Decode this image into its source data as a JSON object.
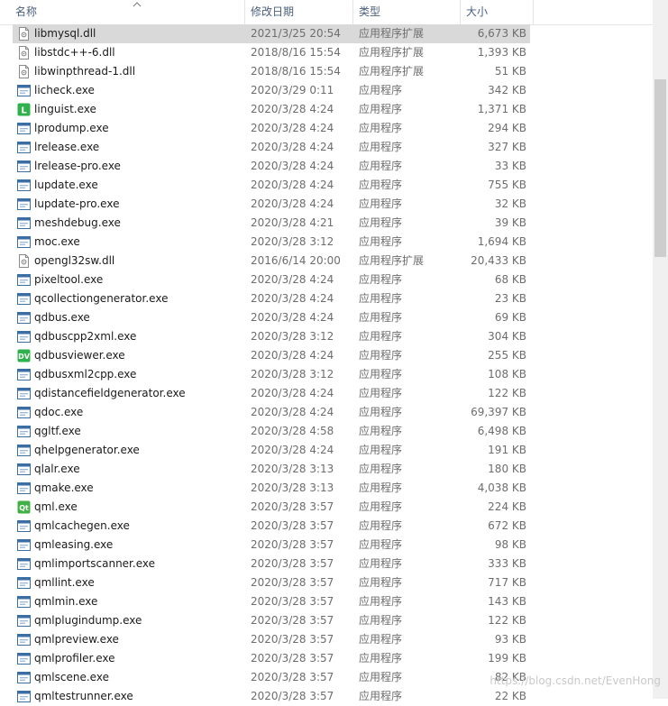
{
  "columns": {
    "name": "名称",
    "date": "修改日期",
    "type": "类型",
    "size": "大小"
  },
  "colors": {
    "selected_row": "#d9d9d9",
    "header_text": "#4c607a",
    "secondary_text": "#6d6d6d",
    "scroll_thumb": "#cdcdcd"
  },
  "files": [
    {
      "name": "libmysql.dll",
      "date": "2021/3/25 20:54",
      "type": "应用程序扩展",
      "size": "6,673 KB",
      "icon": "dll-icon",
      "selected": true
    },
    {
      "name": "libstdc++-6.dll",
      "date": "2018/8/16 15:54",
      "type": "应用程序扩展",
      "size": "1,393 KB",
      "icon": "dll-icon"
    },
    {
      "name": "libwinpthread-1.dll",
      "date": "2018/8/16 15:54",
      "type": "应用程序扩展",
      "size": "51 KB",
      "icon": "dll-icon"
    },
    {
      "name": "licheck.exe",
      "date": "2020/3/29 0:11",
      "type": "应用程序",
      "size": "342 KB",
      "icon": "exe-icon"
    },
    {
      "name": "linguist.exe",
      "date": "2020/3/28 4:24",
      "type": "应用程序",
      "size": "1,371 KB",
      "icon": "linguist-icon"
    },
    {
      "name": "lprodump.exe",
      "date": "2020/3/28 4:24",
      "type": "应用程序",
      "size": "294 KB",
      "icon": "exe-icon"
    },
    {
      "name": "lrelease.exe",
      "date": "2020/3/28 4:24",
      "type": "应用程序",
      "size": "327 KB",
      "icon": "exe-icon"
    },
    {
      "name": "lrelease-pro.exe",
      "date": "2020/3/28 4:24",
      "type": "应用程序",
      "size": "33 KB",
      "icon": "exe-icon"
    },
    {
      "name": "lupdate.exe",
      "date": "2020/3/28 4:24",
      "type": "应用程序",
      "size": "755 KB",
      "icon": "exe-icon"
    },
    {
      "name": "lupdate-pro.exe",
      "date": "2020/3/28 4:24",
      "type": "应用程序",
      "size": "32 KB",
      "icon": "exe-icon"
    },
    {
      "name": "meshdebug.exe",
      "date": "2020/3/28 4:21",
      "type": "应用程序",
      "size": "39 KB",
      "icon": "exe-icon"
    },
    {
      "name": "moc.exe",
      "date": "2020/3/28 3:12",
      "type": "应用程序",
      "size": "1,694 KB",
      "icon": "exe-icon"
    },
    {
      "name": "opengl32sw.dll",
      "date": "2016/6/14 20:00",
      "type": "应用程序扩展",
      "size": "20,433 KB",
      "icon": "dll-icon"
    },
    {
      "name": "pixeltool.exe",
      "date": "2020/3/28 4:24",
      "type": "应用程序",
      "size": "68 KB",
      "icon": "exe-icon"
    },
    {
      "name": "qcollectiongenerator.exe",
      "date": "2020/3/28 4:24",
      "type": "应用程序",
      "size": "23 KB",
      "icon": "exe-icon"
    },
    {
      "name": "qdbus.exe",
      "date": "2020/3/28 4:24",
      "type": "应用程序",
      "size": "69 KB",
      "icon": "exe-icon"
    },
    {
      "name": "qdbuscpp2xml.exe",
      "date": "2020/3/28 3:12",
      "type": "应用程序",
      "size": "304 KB",
      "icon": "exe-icon"
    },
    {
      "name": "qdbusviewer.exe",
      "date": "2020/3/28 4:24",
      "type": "应用程序",
      "size": "255 KB",
      "icon": "dbusviewer-icon"
    },
    {
      "name": "qdbusxml2cpp.exe",
      "date": "2020/3/28 3:12",
      "type": "应用程序",
      "size": "108 KB",
      "icon": "exe-icon"
    },
    {
      "name": "qdistancefieldgenerator.exe",
      "date": "2020/3/28 4:24",
      "type": "应用程序",
      "size": "122 KB",
      "icon": "exe-icon"
    },
    {
      "name": "qdoc.exe",
      "date": "2020/3/28 4:24",
      "type": "应用程序",
      "size": "69,397 KB",
      "icon": "exe-icon"
    },
    {
      "name": "qgltf.exe",
      "date": "2020/3/28 4:58",
      "type": "应用程序",
      "size": "6,498 KB",
      "icon": "exe-icon"
    },
    {
      "name": "qhelpgenerator.exe",
      "date": "2020/3/28 4:24",
      "type": "应用程序",
      "size": "191 KB",
      "icon": "exe-icon"
    },
    {
      "name": "qlalr.exe",
      "date": "2020/3/28 3:13",
      "type": "应用程序",
      "size": "180 KB",
      "icon": "exe-icon"
    },
    {
      "name": "qmake.exe",
      "date": "2020/3/28 3:13",
      "type": "应用程序",
      "size": "4,038 KB",
      "icon": "exe-icon"
    },
    {
      "name": "qml.exe",
      "date": "2020/3/28 3:57",
      "type": "应用程序",
      "size": "224 KB",
      "icon": "qt-icon"
    },
    {
      "name": "qmlcachegen.exe",
      "date": "2020/3/28 3:57",
      "type": "应用程序",
      "size": "672 KB",
      "icon": "exe-icon"
    },
    {
      "name": "qmleasing.exe",
      "date": "2020/3/28 3:57",
      "type": "应用程序",
      "size": "98 KB",
      "icon": "exe-icon"
    },
    {
      "name": "qmlimportscanner.exe",
      "date": "2020/3/28 3:57",
      "type": "应用程序",
      "size": "333 KB",
      "icon": "exe-icon"
    },
    {
      "name": "qmllint.exe",
      "date": "2020/3/28 3:57",
      "type": "应用程序",
      "size": "717 KB",
      "icon": "exe-icon"
    },
    {
      "name": "qmlmin.exe",
      "date": "2020/3/28 3:57",
      "type": "应用程序",
      "size": "143 KB",
      "icon": "exe-icon"
    },
    {
      "name": "qmlplugindump.exe",
      "date": "2020/3/28 3:57",
      "type": "应用程序",
      "size": "122 KB",
      "icon": "exe-icon"
    },
    {
      "name": "qmlpreview.exe",
      "date": "2020/3/28 3:57",
      "type": "应用程序",
      "size": "93 KB",
      "icon": "exe-icon"
    },
    {
      "name": "qmlprofiler.exe",
      "date": "2020/3/28 3:57",
      "type": "应用程序",
      "size": "199 KB",
      "icon": "exe-icon"
    },
    {
      "name": "qmlscene.exe",
      "date": "2020/3/28 3:57",
      "type": "应用程序",
      "size": "82 KB",
      "icon": "exe-icon"
    },
    {
      "name": "qmltestrunner.exe",
      "date": "2020/3/28 3:57",
      "type": "应用程序",
      "size": "22 KB",
      "icon": "exe-icon"
    }
  ],
  "watermark": "https://blog.csdn.net/EvenHong"
}
